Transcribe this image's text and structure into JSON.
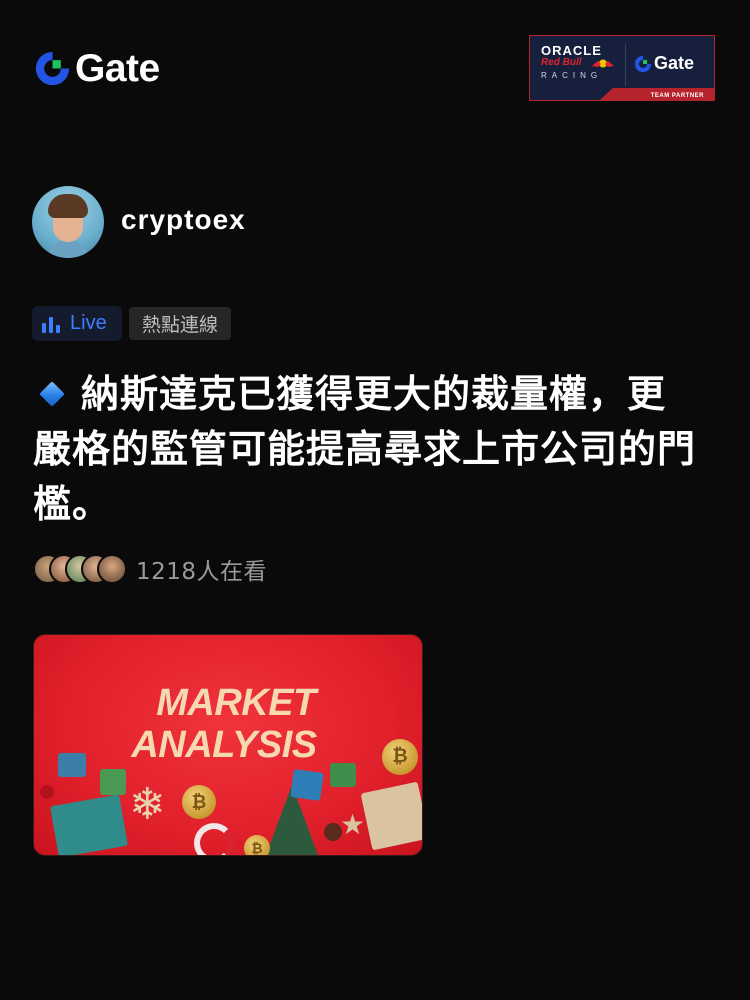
{
  "header": {
    "brand_name": "Gate",
    "partner_banner": {
      "oracle": "ORACLE",
      "redbull": "Red Bull",
      "racing": "RACING",
      "gate": "Gate",
      "tagline": "TEAM PARTNER"
    }
  },
  "author": {
    "name": "cryptoex"
  },
  "tags": {
    "live_label": "Live",
    "hot_label": "熱點連線"
  },
  "headline": {
    "text": "納斯達克已獲得更大的裁量權，更嚴格的監管可能提高尋求上市公司的門檻。"
  },
  "watchers": {
    "count_text": "1218人在看"
  },
  "image_card": {
    "line1": "MARKET",
    "line2": "ANALYSIS",
    "coin_symbol": "₿"
  },
  "colors": {
    "background": "#0a0a0a",
    "accent_blue": "#3d7dff",
    "brand_green": "#19c65f",
    "brand_blue": "#2354e6",
    "card_red": "#e0202b"
  }
}
